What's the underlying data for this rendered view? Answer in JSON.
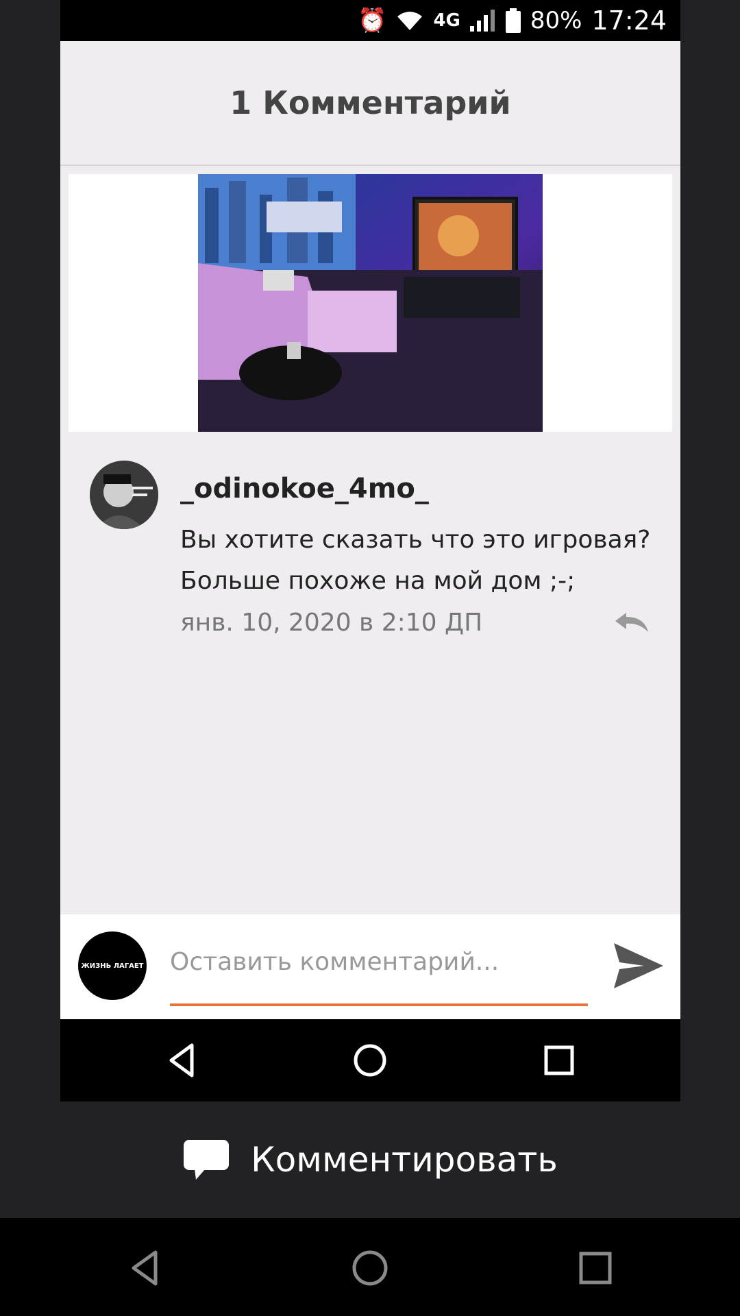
{
  "status_bar": {
    "network": "4G",
    "battery": "80%",
    "time": "17:24"
  },
  "header": {
    "title": "1 Комментарий"
  },
  "comment": {
    "username": "_odinokoe_4mo_",
    "text": "Вы хотите сказать что это игровая? Больше похоже на мой дом ;-;",
    "timestamp": "янв. 10, 2020 в 2:10 ДП"
  },
  "comment_bar": {
    "avatar_label": "ЖИЗНЬ ЛАГАЕТ",
    "placeholder": "Оставить комментарий..."
  },
  "bottom_action": {
    "label": "Комментировать"
  },
  "colors": {
    "accent": "#e8743b"
  }
}
